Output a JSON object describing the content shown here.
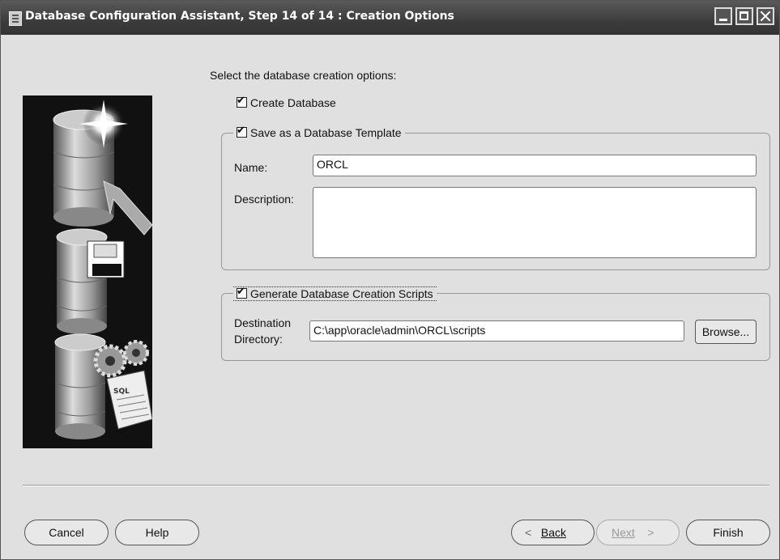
{
  "window": {
    "title": "Database Configuration Assistant, Step 14 of 14 : Creation Options"
  },
  "prompt": "Select the database creation options:",
  "options": {
    "create_database": {
      "label": "Create Database",
      "checked": true
    },
    "save_template": {
      "label": "Save as a Database Template",
      "checked": true,
      "name_label": "Name:",
      "name_value": "ORCL",
      "description_label": "Description:",
      "description_value": ""
    },
    "generate_scripts": {
      "label": "Generate Database Creation Scripts",
      "checked": true,
      "destination_label_line1": "Destination",
      "destination_label_line2": "Directory:",
      "destination_value": "C:\\app\\oracle\\admin\\ORCL\\scripts",
      "browse_label": "Browse..."
    }
  },
  "footer": {
    "cancel": "Cancel",
    "help": "Help",
    "back": "Back",
    "next": "Next",
    "finish": "Finish"
  }
}
